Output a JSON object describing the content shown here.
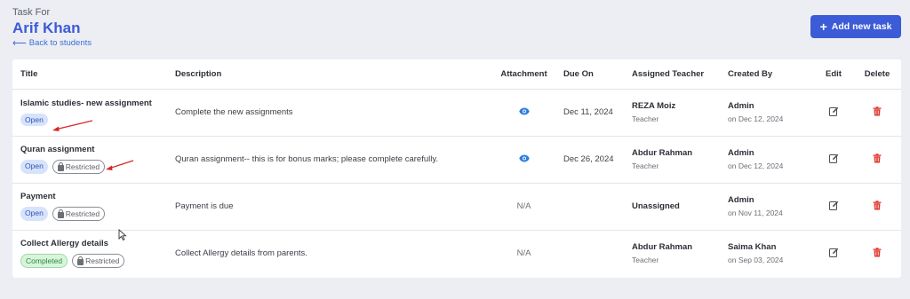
{
  "header": {
    "task_for_label": "Task For",
    "student_name": "Arif Khan",
    "back_link": "Back to students"
  },
  "actions": {
    "add_task": "Add new task"
  },
  "table": {
    "columns": [
      "Title",
      "Description",
      "Attachment",
      "Due On",
      "Assigned Teacher",
      "Created By",
      "Edit",
      "Delete"
    ],
    "rows": [
      {
        "title": "Islamic studies- new assignment",
        "status": "Open",
        "restricted": "",
        "description": "Complete the new assignments",
        "attachment": "eye-icon",
        "due_on": "Dec 11, 2024",
        "teacher": "REZA Moiz",
        "teacher_role": "Teacher",
        "created_by": "Admin",
        "created_on": "on Dec 12, 2024"
      },
      {
        "title": "Quran assignment",
        "status": "Open",
        "restricted": "Restricted",
        "description": "Quran assignment-- this is for bonus marks; please complete carefully.",
        "attachment": "eye-icon",
        "due_on": "Dec 26, 2024",
        "teacher": "Abdur Rahman",
        "teacher_role": "Teacher",
        "created_by": "Admin",
        "created_on": "on Dec 12, 2024"
      },
      {
        "title": "Payment",
        "status": "Open",
        "restricted": "Restricted",
        "description": "Payment is due",
        "attachment": "N/A",
        "due_on": "",
        "teacher": "Unassigned",
        "teacher_role": "",
        "created_by": "Admin",
        "created_on": "on Nov 11, 2024"
      },
      {
        "title": "Collect Allergy details",
        "status": "Completed",
        "restricted": "Restricted",
        "description": "Collect Allergy details from parents.",
        "attachment": "N/A",
        "due_on": "",
        "teacher": "Abdur Rahman",
        "teacher_role": "Teacher",
        "created_by": "Saima Khan",
        "created_on": "on Sep 03, 2024"
      }
    ]
  },
  "colors": {
    "accent": "#3c5bd6",
    "eye": "#2e7de0",
    "edit": "#4a4d53",
    "delete": "#e0352b",
    "annotation_arrow": "#d6262b"
  }
}
